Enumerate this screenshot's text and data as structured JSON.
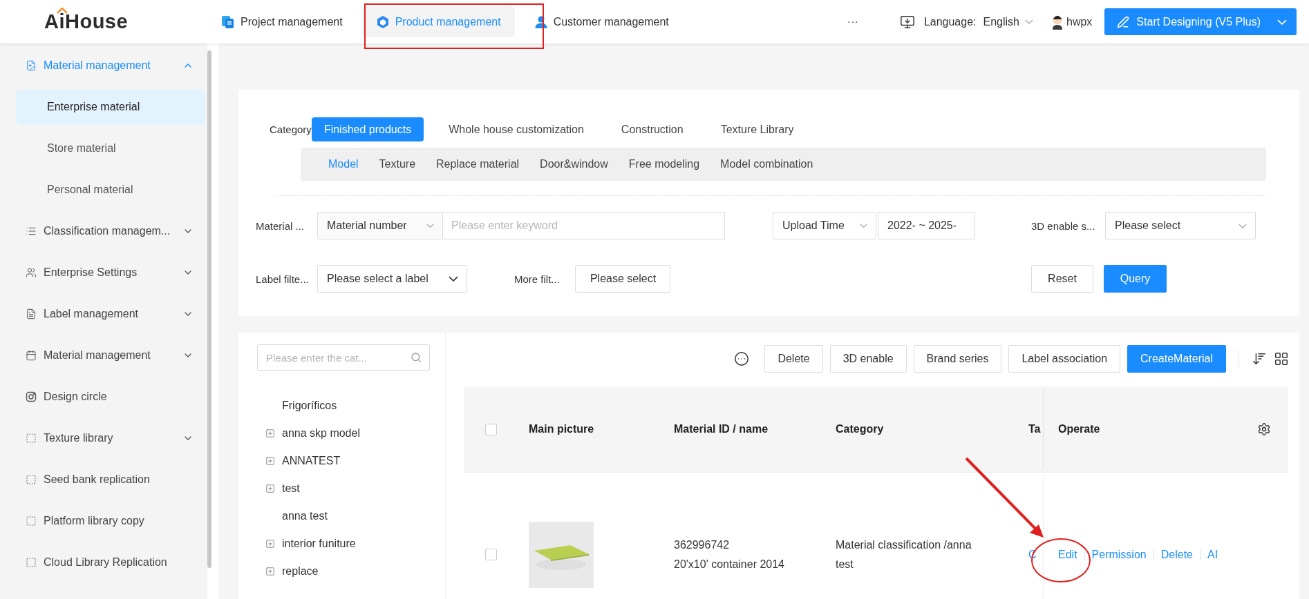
{
  "top_bar": {
    "logo": "AiHouse",
    "nav": [
      {
        "label": "Project management",
        "selected": false
      },
      {
        "label": "Product management",
        "selected": true
      },
      {
        "label": "Customer management",
        "selected": false
      }
    ],
    "more": "···",
    "language_label": "Language:",
    "language": "English",
    "user": "hwpx",
    "start_button": "Start Designing (V5 Plus)"
  },
  "sidebar": {
    "items": [
      {
        "label": "Material management",
        "kind": "group",
        "expanded": true,
        "children": [
          {
            "label": "Enterprise material",
            "selected": true
          },
          {
            "label": "Store material",
            "selected": false
          },
          {
            "label": "Personal material",
            "selected": false
          }
        ]
      },
      {
        "label": "Classification managem...",
        "kind": "group",
        "expanded": false
      },
      {
        "label": "Enterprise Settings",
        "kind": "group",
        "expanded": false
      },
      {
        "label": "Label management",
        "kind": "group",
        "expanded": false
      },
      {
        "label": "Material management",
        "kind": "group",
        "expanded": false
      },
      {
        "label": "Design circle",
        "kind": "link"
      },
      {
        "label": "Texture library",
        "kind": "group",
        "expanded": false
      },
      {
        "label": "Seed bank replication",
        "kind": "link"
      },
      {
        "label": "Platform library copy",
        "kind": "link"
      },
      {
        "label": "Cloud Library Replication",
        "kind": "link"
      }
    ]
  },
  "filters": {
    "category_label": "Category",
    "categories": [
      {
        "label": "Finished products",
        "selected": true
      },
      {
        "label": "Whole house customization",
        "selected": false
      },
      {
        "label": "Construction",
        "selected": false
      },
      {
        "label": "Texture Library",
        "selected": false
      }
    ],
    "subcategories": [
      {
        "label": "Model",
        "selected": true
      },
      {
        "label": "Texture",
        "selected": false
      },
      {
        "label": "Replace material",
        "selected": false
      },
      {
        "label": "Door&window",
        "selected": false
      },
      {
        "label": "Free modeling",
        "selected": false
      },
      {
        "label": "Model combination",
        "selected": false
      }
    ],
    "keyword": {
      "label": "Material ...",
      "type_select": "Material number",
      "placeholder": "Please enter keyword"
    },
    "upload": {
      "select": "Upload Time",
      "range_start": "2022-",
      "separator": "~",
      "range_end": "2025-"
    },
    "enable_3d": {
      "label": "3D enable s...",
      "placeholder": "Please select"
    },
    "label_filter": {
      "label": "Label filte...",
      "placeholder": "Please select a label"
    },
    "more_filters": {
      "label": "More filt...",
      "placeholder": "Please select"
    },
    "buttons": [
      {
        "label": "Reset",
        "kind": "default"
      },
      {
        "label": "Query",
        "kind": "primary"
      }
    ]
  },
  "category_tree": {
    "search_placeholder": "Please enter the cat...",
    "items": [
      {
        "label": "Frigoríficos",
        "kind": "leaf"
      },
      {
        "label": "anna skp model",
        "kind": "branch"
      },
      {
        "label": "ANNATEST",
        "kind": "branch"
      },
      {
        "label": "test",
        "kind": "branch"
      },
      {
        "label": "anna test",
        "kind": "leaf"
      },
      {
        "label": "interior funiture",
        "kind": "branch"
      },
      {
        "label": "replace",
        "kind": "branch"
      }
    ]
  },
  "toolbar": {
    "buttons": [
      {
        "label": "Delete",
        "kind": "default"
      },
      {
        "label": "3D enable",
        "kind": "default"
      },
      {
        "label": "Brand series",
        "kind": "default"
      },
      {
        "label": "Label association",
        "kind": "default"
      },
      {
        "label": "CreateMaterial",
        "kind": "primary"
      }
    ]
  },
  "table": {
    "select_all": {
      "selected": false
    },
    "columns": [
      "Main picture",
      "Material ID / name",
      "Category",
      "Ta"
    ],
    "operate_header": "Operate",
    "rows": [
      {
        "selected": false,
        "picture": {
          "kind": "picture"
        },
        "id": "362996742",
        "name": "20'x10' container 2014",
        "category": "Material classification /anna test",
        "column_5": "C",
        "actions": [
          "Edit",
          "Permission",
          "Delete",
          "AI"
        ]
      }
    ]
  },
  "annotations": [
    {
      "kind": "rectangle"
    },
    {
      "kind": "arrow"
    },
    {
      "kind": "ellipse"
    }
  ]
}
